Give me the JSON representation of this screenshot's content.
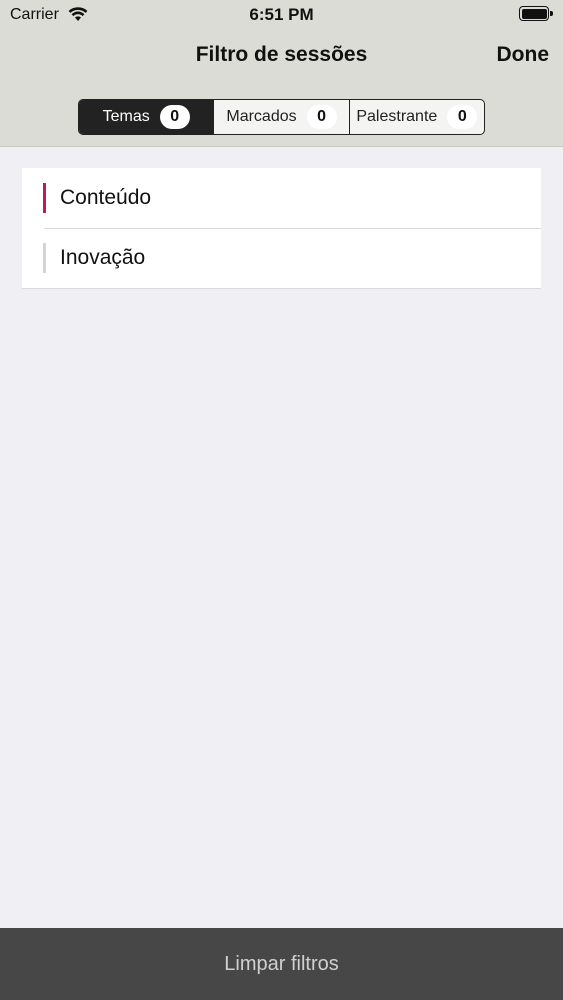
{
  "status": {
    "carrier": "Carrier",
    "time": "6:51 PM"
  },
  "nav": {
    "title": "Filtro de sessões",
    "done_label": "Done"
  },
  "segments": [
    {
      "label": "Temas",
      "count": "0",
      "active": true
    },
    {
      "label": "Marcados",
      "count": "0",
      "active": false
    },
    {
      "label": "Palestrante",
      "count": "0",
      "active": false
    }
  ],
  "list": [
    {
      "label": "Conteúdo",
      "color": "#c2185b"
    },
    {
      "label": "Inovação",
      "color": "#d5d5d5"
    }
  ],
  "footer": {
    "clear_label": "Limpar filtros"
  }
}
